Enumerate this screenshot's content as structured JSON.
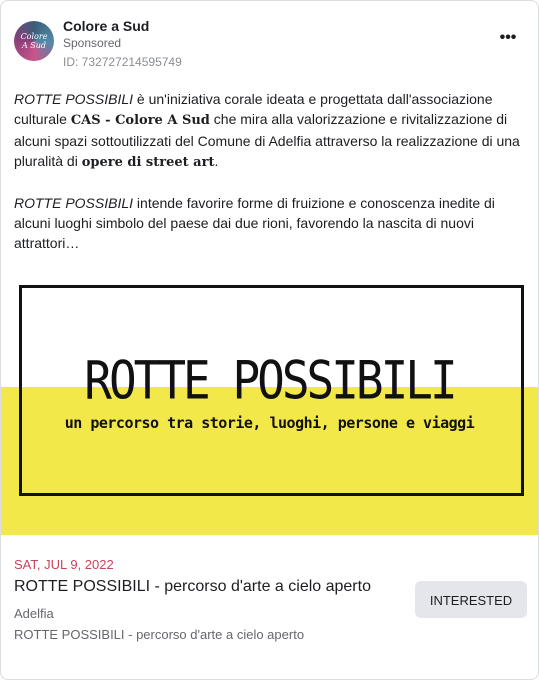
{
  "advertiser": {
    "name": "Colore a Sud",
    "sponsored_label": "Sponsored",
    "ad_id": "ID: 732727214595749",
    "avatar_line1": "Colore",
    "avatar_line2": "A Sud"
  },
  "more_label": "•••",
  "body": {
    "p1_em": "ROTTE POSSIBILI",
    "p1_a": " è un'iniziativa corale ideata e progettata dall'associazione culturale ",
    "p1_bold1": "CAS - Colore A Sud",
    "p1_b": " che mira alla valorizzazione e rivitalizzazione di alcuni spazi sottoutilizzati del Comune di Adelfia attraverso la realizzazione di una pluralità di ",
    "p1_bold2": "opere di street art",
    "p1_c": ".",
    "p2_em": "ROTTE POSSIBILI",
    "p2_a": " intende favorire forme di fruizione e conoscenza inedite di alcuni luoghi simbolo del paese dai due rioni, favorendo la nascita di nuovi attrattori…"
  },
  "banner": {
    "title": "ROTTE POSSIBILI",
    "subtitle": "un percorso tra storie, luoghi, persone e viaggi",
    "accent_color": "#f2e84a"
  },
  "event": {
    "date": "SAT, JUL 9, 2022",
    "title": "ROTTE POSSIBILI - percorso d'arte a cielo aperto",
    "location": "Adelfia",
    "subtitle": "ROTTE POSSIBILI - percorso d'arte a cielo aperto",
    "button_label": "INTERESTED"
  }
}
